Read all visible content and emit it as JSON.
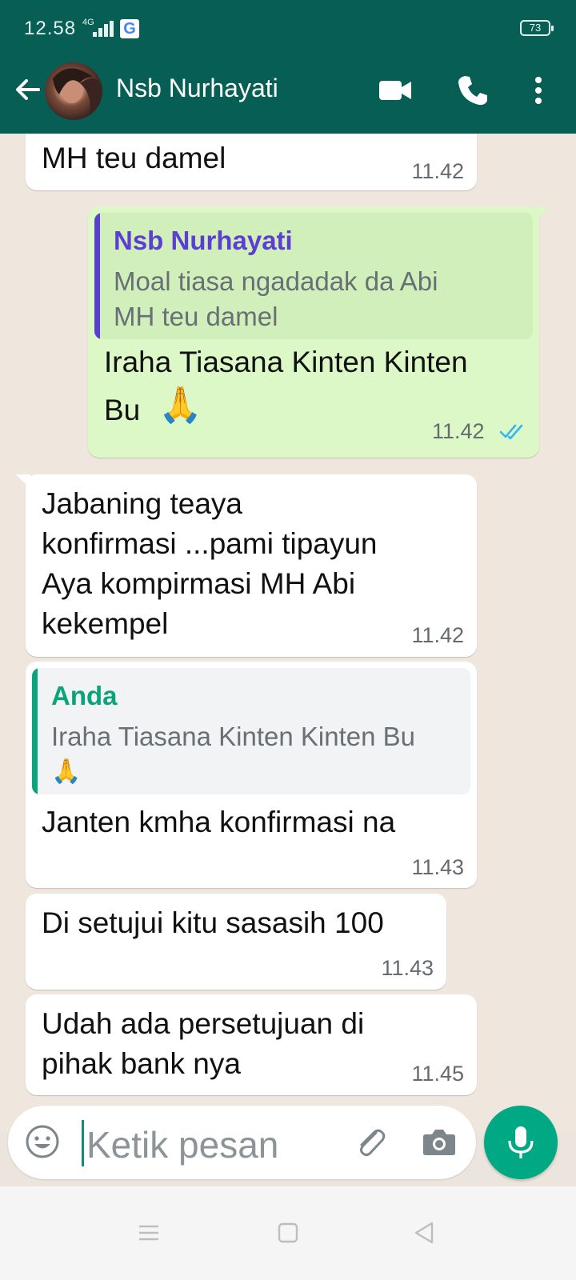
{
  "status_bar": {
    "time": "12.58",
    "network": "4G",
    "battery": "73",
    "g_icon": "G"
  },
  "header": {
    "contact_name": "Nsb Nurhayati"
  },
  "messages": [
    {
      "direction": "incoming",
      "text": "MH teu damel",
      "time": "11.42"
    },
    {
      "direction": "outgoing",
      "quote": {
        "author": "Nsb Nurhayati",
        "text_line1": "Moal tiasa ngadadak da Abi",
        "text_line2": "MH teu damel"
      },
      "text_line1": "Iraha Tiasana Kinten Kinten",
      "text_line2": "Bu",
      "emoji": "🙏",
      "time": "11.42",
      "status": "read"
    },
    {
      "direction": "incoming",
      "lines": [
        "Jabaning teaya",
        "konfirmasi ...pami tipayun",
        "Aya kompirmasi MH Abi",
        "kekempel"
      ],
      "time": "11.42"
    },
    {
      "direction": "incoming",
      "quote": {
        "author": "Anda",
        "text_line1": "Iraha Tiasana Kinten Kinten Bu",
        "emoji": "🙏"
      },
      "text": "Janten kmha konfirmasi na",
      "time": "11.43"
    },
    {
      "direction": "incoming",
      "text": "Di setujui kitu sasasih 100",
      "time": "11.43"
    },
    {
      "direction": "incoming",
      "lines": [
        "Udah ada persetujuan di",
        "pihak bank nya"
      ],
      "time": "11.45"
    }
  ],
  "input": {
    "placeholder": "Ketik pesan"
  },
  "colors": {
    "header": "#075e54",
    "outgoing_bubble": "#dcf8c6",
    "incoming_bubble": "#ffffff",
    "accent": "#00a884",
    "quote_out_bar": "#5a3fd0",
    "quote_in_bar": "#0aa37b"
  },
  "icons": [
    "back-arrow-icon",
    "video-call-icon",
    "phone-icon",
    "more-vert-icon",
    "double-check-icon",
    "emoji-icon",
    "attach-icon",
    "camera-icon",
    "mic-icon",
    "nav-menu-icon",
    "nav-home-icon",
    "nav-back-icon"
  ]
}
